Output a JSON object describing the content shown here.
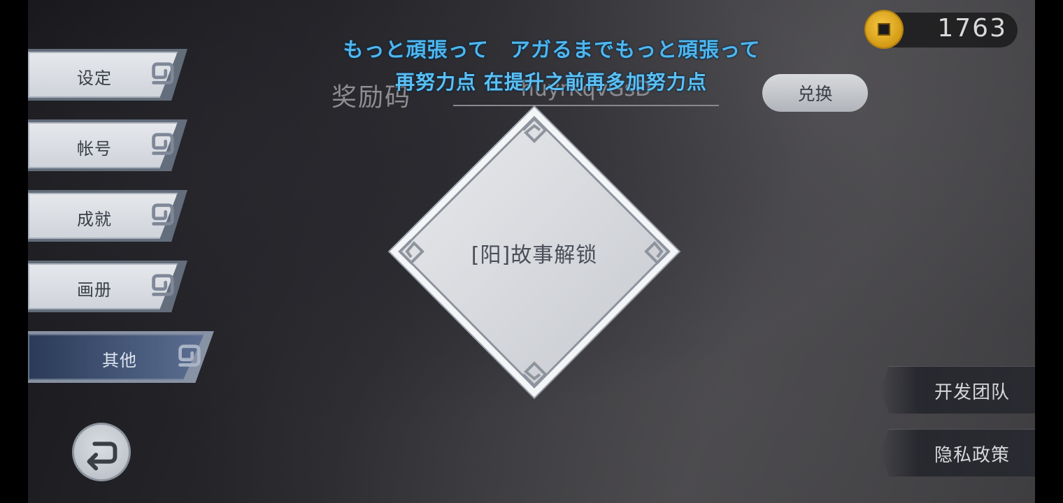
{
  "subtitles": {
    "line1": "もっと頑張って　アガるまでもっと頑張って",
    "line2": "再努力点 在提升之前再多加努力点"
  },
  "currency": {
    "value": "1763",
    "icon": "coin-icon"
  },
  "sidebar": {
    "items": [
      {
        "label": "设定",
        "active": false
      },
      {
        "label": "帐号",
        "active": false
      },
      {
        "label": "成就",
        "active": false
      },
      {
        "label": "画册",
        "active": false
      },
      {
        "label": "其他",
        "active": true
      }
    ],
    "back_icon": "return-arrow-icon"
  },
  "reward": {
    "label": "奖励码",
    "code_value": "huyrKqvGsD",
    "redeem_label": "兑换"
  },
  "card": {
    "label": "[阳]故事解锁"
  },
  "right_buttons": {
    "dev_team": "开发团队",
    "privacy": "隐私政策"
  },
  "colors": {
    "subtitle": "#4fb6ee",
    "active_tab": "#2a3a58",
    "coin": "#e0a820"
  }
}
